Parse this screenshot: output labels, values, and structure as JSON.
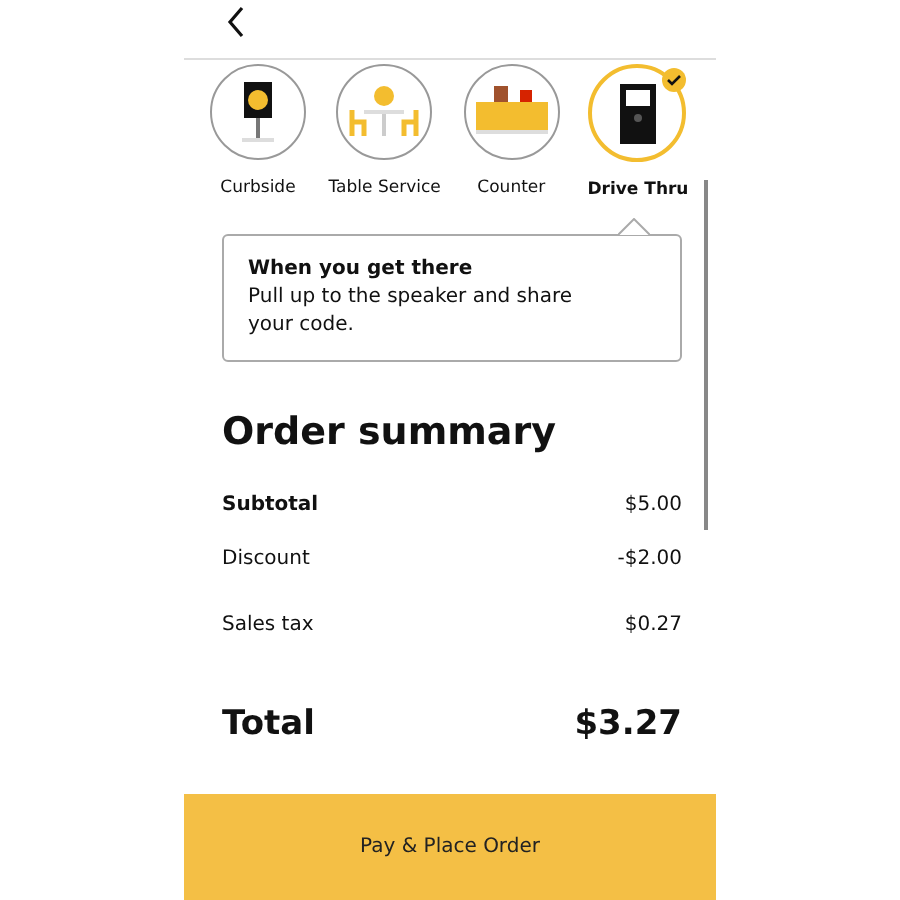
{
  "options": [
    {
      "kind": "curbside",
      "label": "Curbside",
      "selected": false
    },
    {
      "kind": "table",
      "label": "Table Service",
      "selected": false
    },
    {
      "kind": "counter",
      "label": "Counter",
      "selected": false
    },
    {
      "kind": "drive",
      "label": "Drive Thru",
      "selected": true
    }
  ],
  "tip": {
    "title": "When you get there",
    "body": "Pull up to the speaker and share your code."
  },
  "summary": {
    "title": "Order summary",
    "rows": [
      {
        "kind": "subtotal",
        "label": "Subtotal",
        "amount": "$5.00"
      },
      {
        "kind": "line",
        "label": "Discount",
        "amount": "-$2.00"
      },
      {
        "kind": "tax",
        "label": "Sales tax",
        "amount": "$0.27"
      }
    ],
    "total": {
      "label": "Total",
      "amount": "$3.27"
    }
  },
  "button": "Pay & Place Order"
}
